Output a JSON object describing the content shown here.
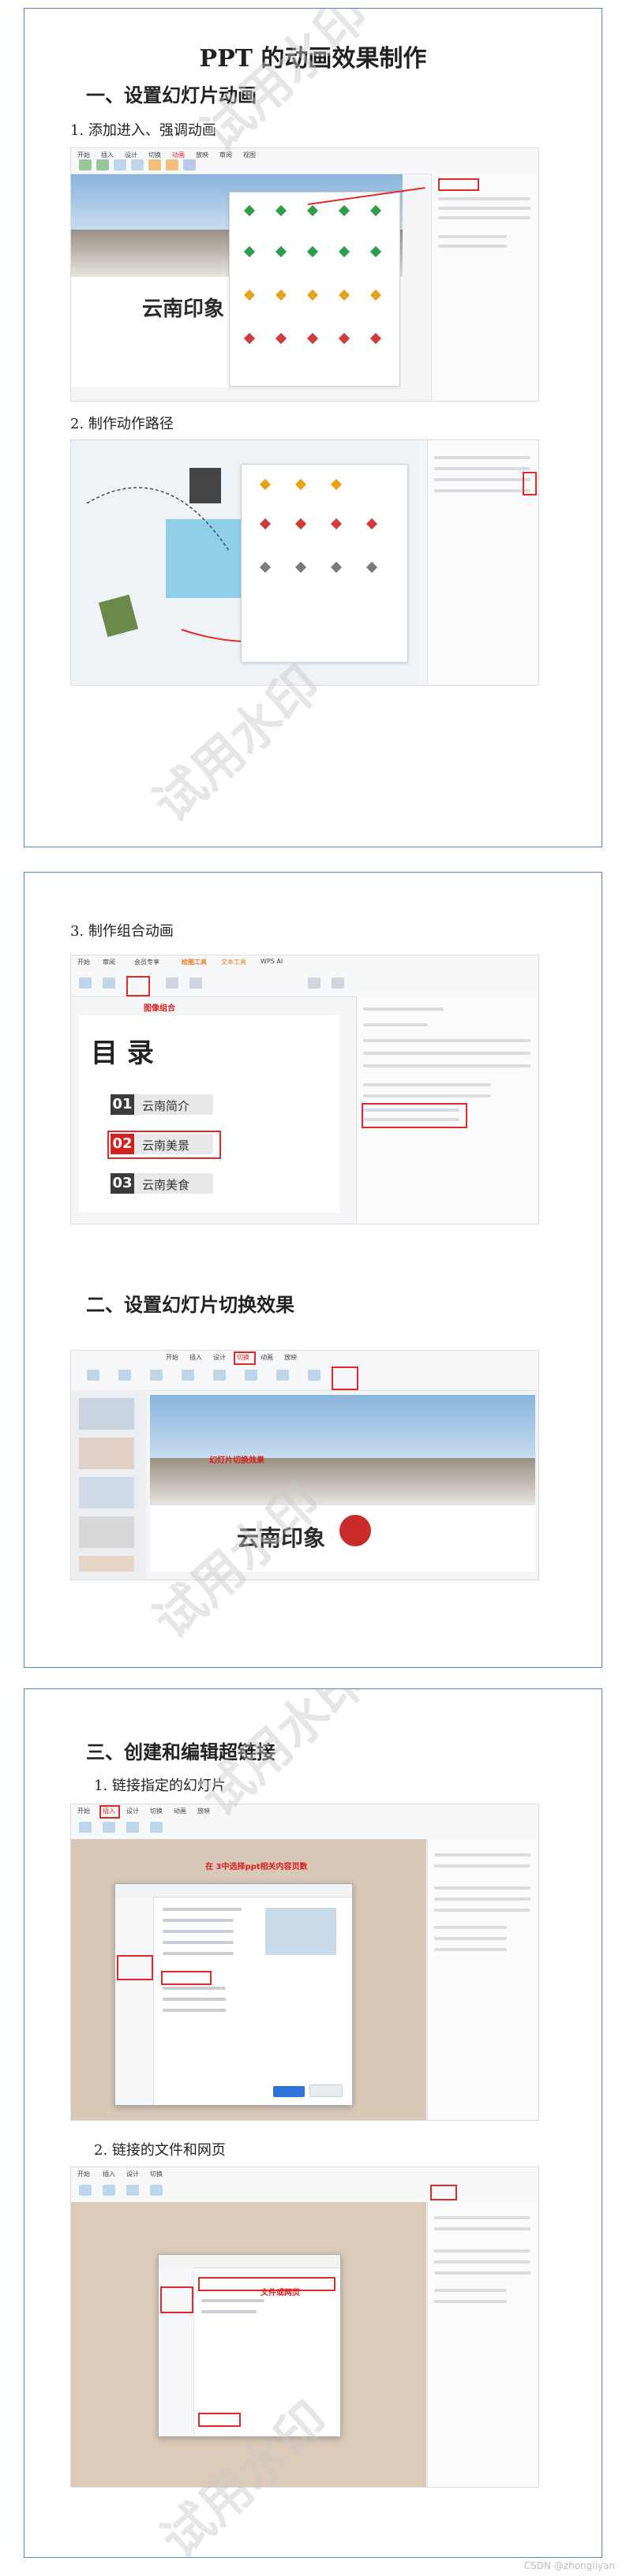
{
  "document": {
    "title": "PPT 的动画效果制作",
    "sections": [
      {
        "heading": "一、设置幻灯片动画",
        "steps": [
          "1. 添加进入、强调动画",
          "2. 制作动作路径",
          "3. 制作组合动画"
        ]
      },
      {
        "heading": "二、设置幻灯片切换效果",
        "steps": []
      },
      {
        "heading": "三、创建和编辑超链接",
        "steps": [
          "1. 链接指定的幻灯片",
          "2. 链接的文件和网页"
        ]
      }
    ]
  },
  "screenshots": {
    "slide_title": "云南印象",
    "menu_tabs": [
      "开始",
      "插入",
      "设计",
      "切换",
      "动画",
      "放映",
      "审阅",
      "视图",
      "工具",
      "会员专享",
      "绘图工具",
      "文本工具",
      "WPS AI"
    ],
    "group_anim": {
      "annotation": "图像组合",
      "toc_heading": "目 录",
      "items": [
        {
          "num": "01",
          "label": "云南简介"
        },
        {
          "num": "02",
          "label": "云南美景"
        },
        {
          "num": "03",
          "label": "云南美食"
        }
      ]
    },
    "transition_annotation": "幻灯片切换效果",
    "hyperlink_annotation": "在 3中选择ppt相关内容页数",
    "file_annotation": "文件或网页"
  },
  "watermark": "试用水印",
  "credit": "CSDN @zhongliyan",
  "colors": {
    "border": "#5b7fbf",
    "accent_red": "#e02a2a",
    "wps_orange": "#f5a623"
  }
}
